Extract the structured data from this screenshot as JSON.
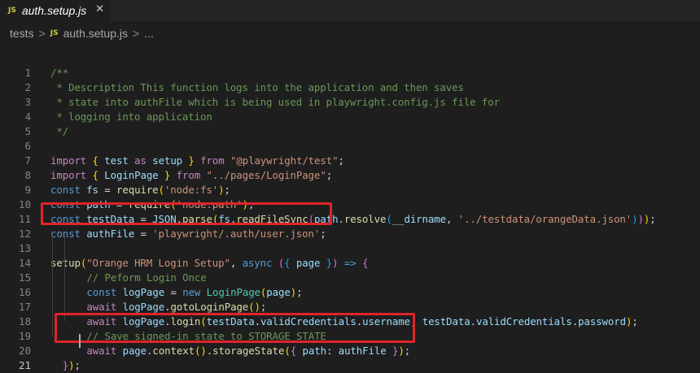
{
  "tab": {
    "badge": "JS",
    "filename": "auth.setup.js",
    "close_glyph": "✕"
  },
  "breadcrumb": {
    "folder": "tests",
    "sep1": ">",
    "badge": "JS",
    "file": "auth.setup.js",
    "sep2": ">",
    "ellipsis": "..."
  },
  "editor": {
    "active_line": 21,
    "highlight_color": "#e0242a",
    "line_numbers": [
      "1",
      "2",
      "3",
      "4",
      "5",
      "6",
      "7",
      "8",
      "9",
      "10",
      "11",
      "12",
      "13",
      "14",
      "15",
      "16",
      "17",
      "18",
      "19",
      "20",
      "21"
    ],
    "lines": [
      [
        "/**"
      ],
      [
        " * Description This function logs into the application and then saves"
      ],
      [
        " * state into authFile which is being used in playwright.config.js file for"
      ],
      [
        " * logging into application"
      ],
      [
        " */"
      ],
      [],
      [
        "import",
        " ",
        "{",
        " ",
        "test",
        " ",
        "as",
        " ",
        "setup",
        " ",
        "}",
        " ",
        "from",
        " ",
        "\"@playwright/test\"",
        ";"
      ],
      [
        "import",
        " ",
        "{",
        " ",
        "LoginPage",
        " ",
        "}",
        " ",
        "from",
        " ",
        "\"../pages/LoginPage\"",
        ";"
      ],
      [
        "const",
        " ",
        "fs",
        " = ",
        "require",
        "(",
        "'node:fs'",
        ")",
        ";"
      ],
      [
        "const",
        " ",
        "path",
        " = ",
        "require",
        "(",
        "'node:path'",
        ")",
        ";"
      ],
      [
        "const",
        " ",
        "testData",
        " = ",
        "JSON",
        ".",
        "parse",
        "(",
        "fs",
        ".",
        "readFileSync",
        "(",
        "path",
        ".",
        "resolve",
        "(",
        "__dirname",
        ", ",
        "'../testdata/orangeData.json'",
        ")",
        ")",
        ")",
        ";"
      ],
      [
        "const",
        " ",
        "authFile",
        " = ",
        "'playwright/.auth/user.json'",
        ";"
      ],
      [],
      [
        "setup",
        "(",
        "\"Orange HRM Login Setup\"",
        ", ",
        "async",
        " ",
        "(",
        "{",
        " ",
        "page",
        " ",
        "}",
        ")",
        " ",
        "=>",
        " ",
        "{"
      ],
      [
        "// Peform Login Once"
      ],
      [
        "const",
        " ",
        "logPage",
        " = ",
        "new",
        " ",
        "LoginPage",
        "(",
        "page",
        ")",
        ";"
      ],
      [
        "await",
        " ",
        "logPage",
        ".",
        "gotoLoginPage",
        "(",
        ")",
        ";"
      ],
      [
        "await",
        " ",
        "logPage",
        ".",
        "login",
        "(",
        "testData",
        ".",
        "validCredentials",
        ".",
        "username",
        ", ",
        "testData",
        ".",
        "validCredentials",
        ".",
        "password",
        ")",
        ";"
      ],
      [
        "// Save signed-in state to STORAGE_STATE"
      ],
      [
        "await",
        " ",
        "page",
        ".",
        "context",
        "(",
        ")",
        ".",
        "storageState",
        "(",
        "{",
        " ",
        "path",
        ": ",
        "authFile",
        " ",
        "}",
        ")",
        ";"
      ],
      [
        "}",
        ")",
        ";"
      ]
    ]
  }
}
